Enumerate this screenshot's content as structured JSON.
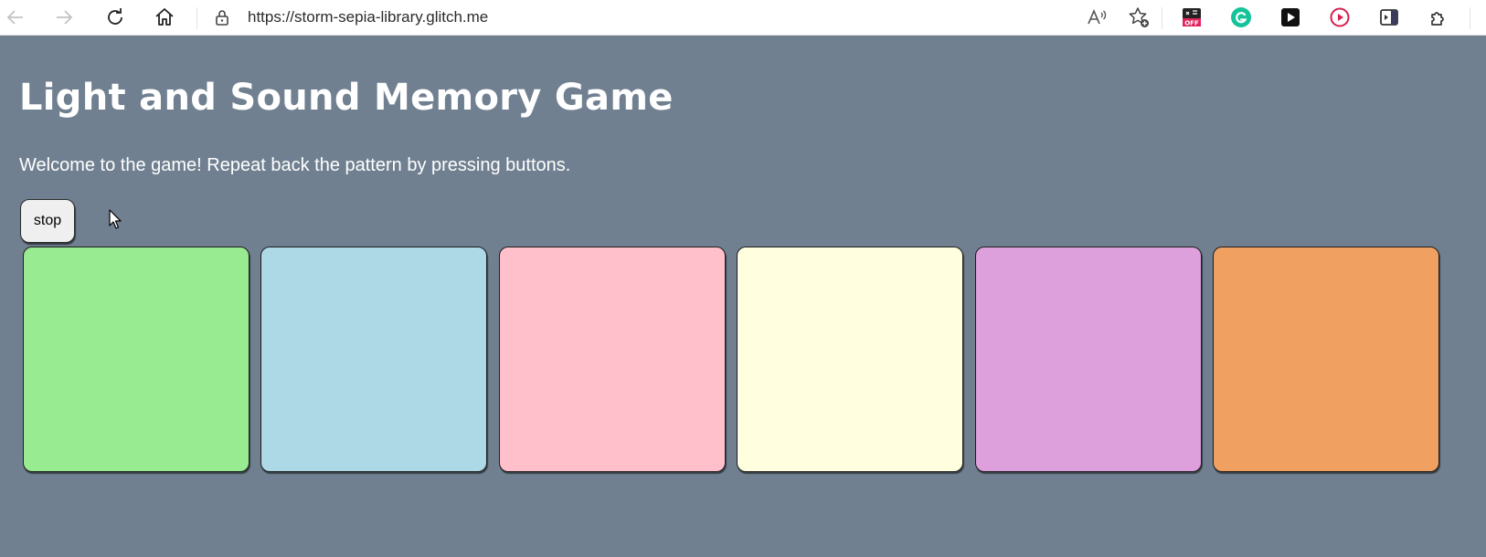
{
  "browser": {
    "url": "https://storm-sepia-library.glitch.me",
    "icons": {
      "back": "arrow-left-icon",
      "forward": "arrow-right-icon",
      "reload": "reload-icon",
      "home": "home-icon",
      "lock": "lock-icon",
      "read_aloud": "read-aloud-icon",
      "favorites": "favorite-add-icon",
      "extensions": "puzzle-icon"
    },
    "extensions": [
      {
        "name": "coupon-off-extension-icon",
        "badge": "OFF",
        "color": "#e0245e"
      },
      {
        "name": "grammarly-extension-icon",
        "color": "#15c39a"
      },
      {
        "name": "play-extension-icon",
        "color": "#111111"
      },
      {
        "name": "video-player-extension-icon",
        "color": "#d6204e"
      },
      {
        "name": "sidebar-extension-icon",
        "color": "#3b3b5c"
      }
    ]
  },
  "page": {
    "background": "#708090",
    "title": "Light and Sound Memory Game",
    "intro": "Welcome to the game! Repeat back the pattern by pressing buttons.",
    "stop_label": "stop",
    "pads": [
      {
        "id": 1,
        "color": "#98eb90"
      },
      {
        "id": 2,
        "color": "#add8e6"
      },
      {
        "id": 3,
        "color": "#ffc0cb"
      },
      {
        "id": 4,
        "color": "#ffffe0"
      },
      {
        "id": 5,
        "color": "#dda0dd"
      },
      {
        "id": 6,
        "color": "#f0a060"
      }
    ]
  }
}
